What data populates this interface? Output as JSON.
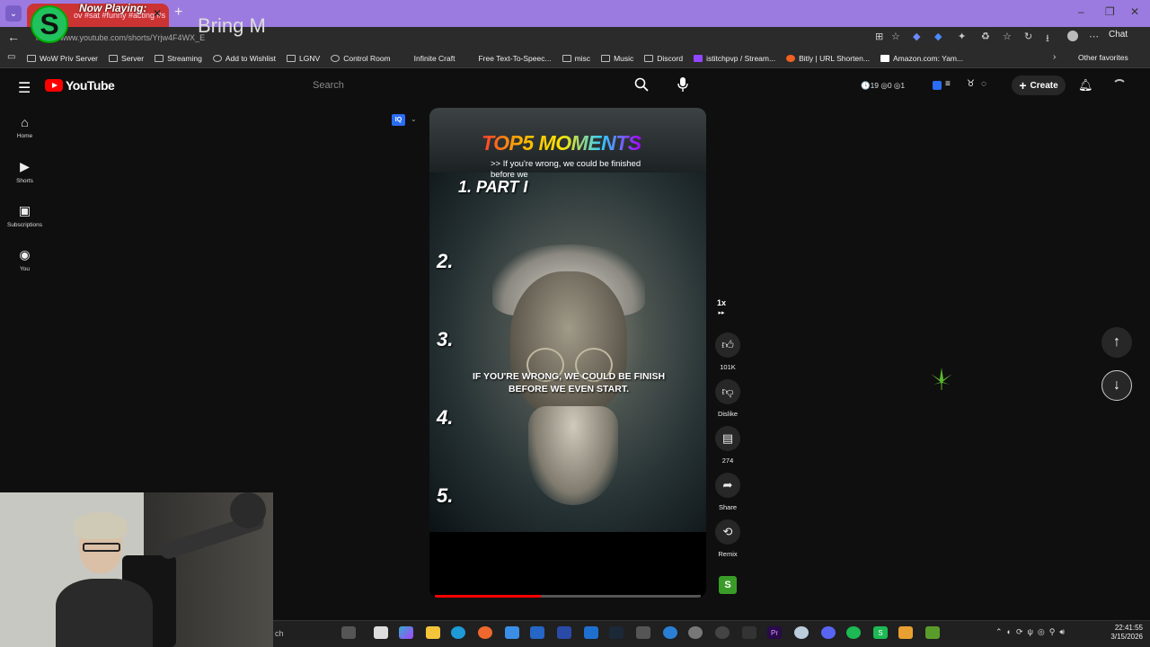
{
  "browser": {
    "tab_title": "ov #sat #funny #acting #s",
    "url": "https://www.youtube.com/shorts/Yrjw4F4WX_E",
    "chat_label": "Chat",
    "bookmarks": [
      "WoW Priv Server",
      "Server",
      "Streaming",
      "Add to Wishlist",
      "LGNV",
      "Control Room",
      "Infinite Craft",
      "Free Text-To-Speec...",
      "misc",
      "Music",
      "Discord",
      "istitchpvp / Stream...",
      "Bitly | URL Shorten...",
      "Amazon.com: Yam..."
    ],
    "other_favorites": "Other favorites"
  },
  "overlay": {
    "logo_letter": "S",
    "now_playing": "Now Playing:",
    "song_text": "Bring M"
  },
  "youtube": {
    "logo_text": "YouTube",
    "search_placeholder": "Search",
    "counters": "🕓19  ◎0  ◎1",
    "create_label": "Create",
    "nav": [
      {
        "label": "Home",
        "icon": "home-icon"
      },
      {
        "label": "Shorts",
        "icon": "shorts-icon"
      },
      {
        "label": "Subscriptions",
        "icon": "subscriptions-icon"
      },
      {
        "label": "You",
        "icon": "you-icon"
      }
    ]
  },
  "short": {
    "title": "TOP5 MOMENTS",
    "caption": ">> If you're wrong, we could be finished before we",
    "part": "1. PART I",
    "ranks": [
      "2.",
      "3.",
      "4.",
      "5."
    ],
    "subtitle": "IF YOU'RE WRONG, WE COULD BE FINISH BEFORE WE EVEN START.",
    "progress_fraction": 0.4,
    "iq_badge": "IQ",
    "speed": "1x"
  },
  "actions": {
    "like_count": "101K",
    "dislike_label": "Dislike",
    "comment_count": "274",
    "share_label": "Share",
    "remix_label": "Remix",
    "channel_avatar": "S"
  },
  "taskbar": {
    "search_text": "ch",
    "time": "22:41:55",
    "date": "3/15/2026"
  }
}
